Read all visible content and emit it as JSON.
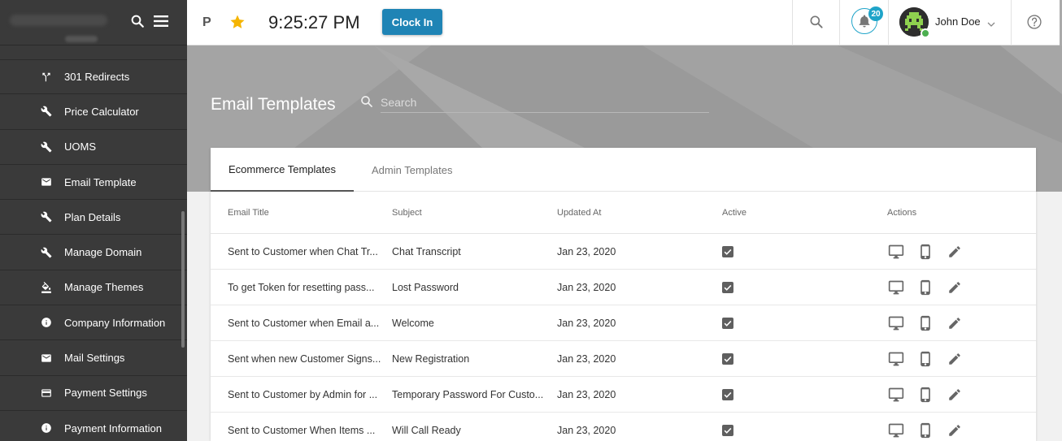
{
  "sidebar": {
    "items": [
      {
        "label": "301 Redirects",
        "icon": "redirect-icon"
      },
      {
        "label": "Price Calculator",
        "icon": "wrench-icon"
      },
      {
        "label": "UOMS",
        "icon": "wrench-icon"
      },
      {
        "label": "Email Template",
        "icon": "mail-icon"
      },
      {
        "label": "Plan Details",
        "icon": "wrench-icon"
      },
      {
        "label": "Manage Domain",
        "icon": "wrench-icon"
      },
      {
        "label": "Manage Themes",
        "icon": "paint-bucket-icon"
      },
      {
        "label": "Company Information",
        "icon": "info-icon"
      },
      {
        "label": "Mail Settings",
        "icon": "mail-icon"
      },
      {
        "label": "Payment Settings",
        "icon": "credit-card-icon"
      },
      {
        "label": "Payment Information",
        "icon": "info-icon"
      }
    ]
  },
  "header": {
    "p_label": "P",
    "time": "9:25:27 PM",
    "clock_in_label": "Clock In",
    "notification_count": "20",
    "user_name": "John Doe"
  },
  "page": {
    "title": "Email Templates",
    "search_placeholder": "Search"
  },
  "tabs": [
    {
      "label": "Ecommerce Templates",
      "active": true
    },
    {
      "label": "Admin Templates",
      "active": false
    }
  ],
  "table": {
    "columns": [
      "Email Title",
      "Subject",
      "Updated At",
      "Active",
      "Actions"
    ],
    "rows": [
      {
        "title": "Sent to Customer when Chat Tr...",
        "subject": "Chat Transcript",
        "updated": "Jan 23, 2020",
        "active": true
      },
      {
        "title": "To get Token for resetting pass...",
        "subject": "Lost Password",
        "updated": "Jan 23, 2020",
        "active": true
      },
      {
        "title": "Sent to Customer when Email a...",
        "subject": "Welcome",
        "updated": "Jan 23, 2020",
        "active": true
      },
      {
        "title": "Sent when new Customer Signs...",
        "subject": "New Registration",
        "updated": "Jan 23, 2020",
        "active": true
      },
      {
        "title": "Sent to Customer by Admin for ...",
        "subject": "Temporary Password For Custo...",
        "updated": "Jan 23, 2020",
        "active": true
      },
      {
        "title": "Sent to Customer When Items ...",
        "subject": "Will Call Ready",
        "updated": "Jan 23, 2020",
        "active": true
      }
    ]
  },
  "colors": {
    "sidebar_bg": "#3a3a3a",
    "accent": "#1f84b5",
    "notification": "#1fa4c9",
    "star": "#f5b400",
    "banner": "#9a9a9a"
  }
}
